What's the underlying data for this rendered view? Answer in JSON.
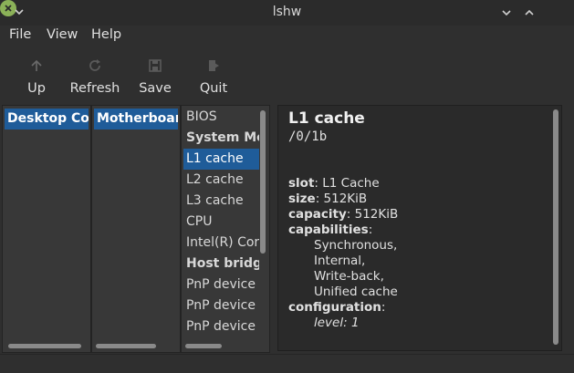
{
  "window": {
    "title": "lshw"
  },
  "menu": {
    "file": "File",
    "view": "View",
    "help": "Help"
  },
  "toolbar": {
    "up": "Up",
    "refresh": "Refresh",
    "save": "Save",
    "quit": "Quit"
  },
  "columns": {
    "col1": "Desktop Computer",
    "col2": "Motherboard"
  },
  "list": [
    {
      "label": "BIOS"
    },
    {
      "label": "System Memory"
    },
    {
      "label": "L1 cache"
    },
    {
      "label": "L2 cache"
    },
    {
      "label": "L3 cache"
    },
    {
      "label": "CPU"
    },
    {
      "label": "Intel(R) Core"
    },
    {
      "label": "Host bridge"
    },
    {
      "label": "PnP device"
    },
    {
      "label": "PnP device"
    },
    {
      "label": "PnP device"
    }
  ],
  "detail": {
    "title": "L1 cache",
    "path": "/0/1b",
    "slot_key": "slot",
    "slot_val": "L1 Cache",
    "size_key": "size",
    "size_val": "512KiB",
    "capacity_key": "capacity",
    "capacity_val": "512KiB",
    "capabilities_key": "capabilities",
    "capabilities": [
      "Synchronous,",
      "Internal,",
      "Write-back,",
      "Unified cache"
    ],
    "configuration_key": "configuration",
    "configuration": "level: 1"
  }
}
